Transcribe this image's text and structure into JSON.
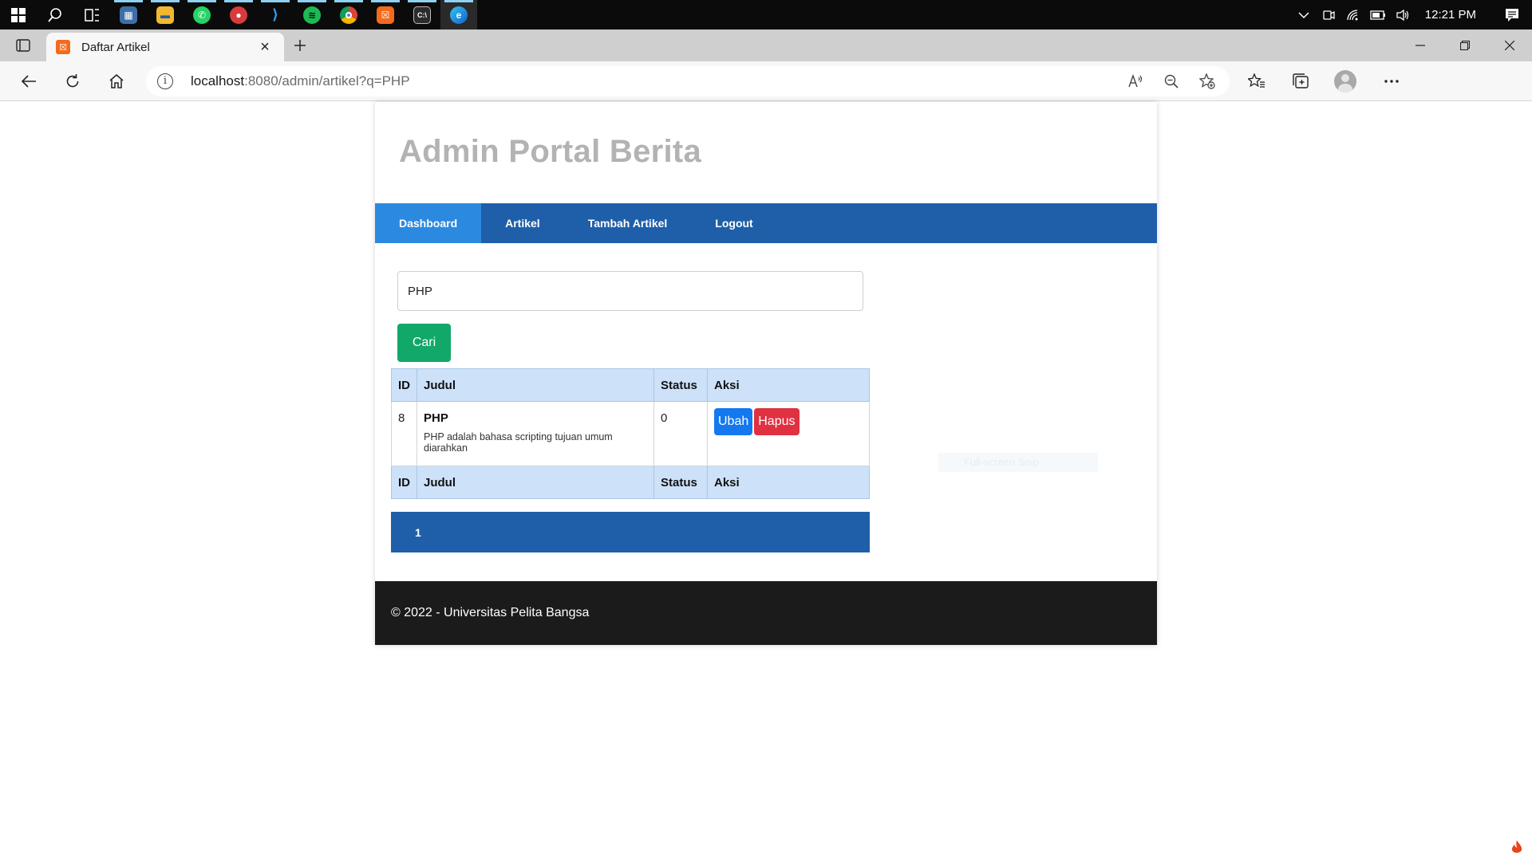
{
  "taskbar": {
    "apps": [
      {
        "name": "start",
        "icon": "windows-icon"
      },
      {
        "name": "search",
        "icon": "search-icon"
      },
      {
        "name": "task-view",
        "icon": "task-view-icon"
      },
      {
        "name": "photos",
        "icon": "photos-icon"
      },
      {
        "name": "file-explorer",
        "icon": "folder-icon"
      },
      {
        "name": "whatsapp",
        "icon": "whatsapp-icon"
      },
      {
        "name": "rambox",
        "icon": "app-icon"
      },
      {
        "name": "vscode",
        "icon": "vscode-icon"
      },
      {
        "name": "spotify",
        "icon": "spotify-icon"
      },
      {
        "name": "chrome",
        "icon": "chrome-icon"
      },
      {
        "name": "xampp",
        "icon": "xampp-icon"
      },
      {
        "name": "terminal",
        "icon": "terminal-icon"
      },
      {
        "name": "edge",
        "icon": "edge-icon"
      }
    ],
    "clock": "12:21 PM"
  },
  "browser": {
    "tab_title": "Daftar Artikel",
    "url_host": "localhost",
    "url_rest": ":8080/admin/artikel?q=PHP"
  },
  "page": {
    "site_title": "Admin Portal Berita",
    "nav": [
      {
        "label": "Dashboard",
        "active": true
      },
      {
        "label": "Artikel",
        "active": false
      },
      {
        "label": "Tambah Artikel",
        "active": false
      },
      {
        "label": "Logout",
        "active": false
      }
    ],
    "search": {
      "value": "PHP",
      "button_label": "Cari"
    },
    "table": {
      "headers": [
        "ID",
        "Judul",
        "Status",
        "Aksi"
      ],
      "rows": [
        {
          "id": "8",
          "title": "PHP",
          "desc": "PHP adalah bahasa scripting tujuan umum diarahkan",
          "status": "0",
          "edit_label": "Ubah",
          "delete_label": "Hapus"
        }
      ]
    },
    "pagination": {
      "current": "1"
    },
    "footer": "© 2022 - Universitas Pelita Bangsa",
    "snip_overlay": "Full-screen Snip"
  },
  "colors": {
    "nav_bg": "#1f5fa9",
    "nav_active": "#2c89e0",
    "search_button": "#11a86a",
    "edit_button": "#1478ef",
    "delete_button": "#e03141",
    "table_header": "#cde2f9",
    "footer_bg": "#1b1b1b"
  }
}
